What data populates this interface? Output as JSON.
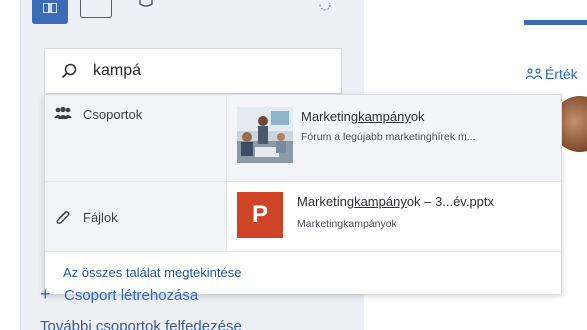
{
  "search": {
    "value": "kampá"
  },
  "results": {
    "groups": {
      "category_label": "Csoportok",
      "item": {
        "title_prefix": "Marketing",
        "title_match": "kampány",
        "title_suffix": "ok",
        "subtitle": "Fórum a legújabb marketinghírek m..."
      }
    },
    "files": {
      "category_label": "Fájlok",
      "item": {
        "icon_letter": "P",
        "title_prefix": "Marketing",
        "title_match": "kampány",
        "title_suffix": "ok – 3...év.pptx",
        "subtitle": "Marketingkampányok"
      }
    },
    "footer_link": "Az összes találat megtekintése"
  },
  "right_panel": {
    "link_text": "Érték"
  },
  "sidebar_below": {
    "create_group": "Csoport létrehozása",
    "more_groups": "További csoportok felfedezése"
  },
  "colors": {
    "accent": "#3a6cb7",
    "link": "#2a69c8",
    "powerpoint": "#cf4426"
  },
  "icons": {
    "search": "search-icon",
    "groups": "groups-icon",
    "files": "paperclip-icon",
    "powerpoint": "powerpoint-icon"
  }
}
